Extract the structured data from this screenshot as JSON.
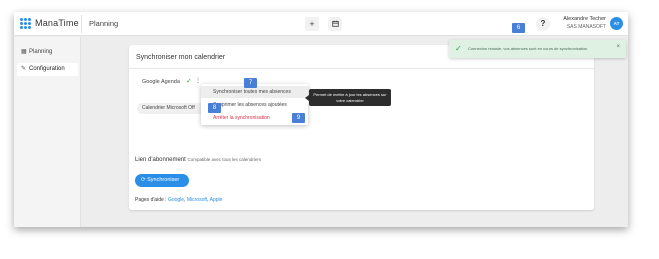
{
  "app": {
    "brand": "ManaTime",
    "nav_title": "Planning"
  },
  "toolbar": {
    "add_icon": "+",
    "calendar_icon": "calendar"
  },
  "user": {
    "name": "Alexandre Techer",
    "company": "SAS MANASOFT",
    "initials": "AT",
    "help": "?"
  },
  "sidebar": {
    "items": [
      {
        "label": "Planning",
        "icon": "calendar-icon"
      },
      {
        "label": "Configuration",
        "icon": "wrench-icon"
      }
    ]
  },
  "card": {
    "title": "Synchroniser mon calendrier",
    "google_label": "Google Agenda",
    "microsoft_label": "Calendrier Microsoft Off"
  },
  "menu": {
    "items": [
      {
        "label": "Synchroniser toutes mes absences"
      },
      {
        "label": "Supprimer les absences ajoutées"
      },
      {
        "label": "Arrêter la synchronisation"
      }
    ]
  },
  "tooltip": {
    "text": "Permet de mettre à jour les absences sur votre calendrier"
  },
  "badges": {
    "b6": "6",
    "b7": "7",
    "b8": "8",
    "b9": "9"
  },
  "subscription": {
    "title": "Lien d'abonnement",
    "subtitle": "Compatible avec tous les calendriers",
    "button": "Synchroniser"
  },
  "help_pages": {
    "label": "Pages d'aide :",
    "links": [
      "Google",
      "Microsoft",
      "Apple"
    ]
  },
  "toast": {
    "message": "Connexion réussie, vos absences sont en cours de synchronisation",
    "close": "×"
  },
  "colors": {
    "accent": "#2b8fe8",
    "success": "#2aa24a",
    "danger": "#d9304c",
    "badge": "#4a7fd8"
  }
}
